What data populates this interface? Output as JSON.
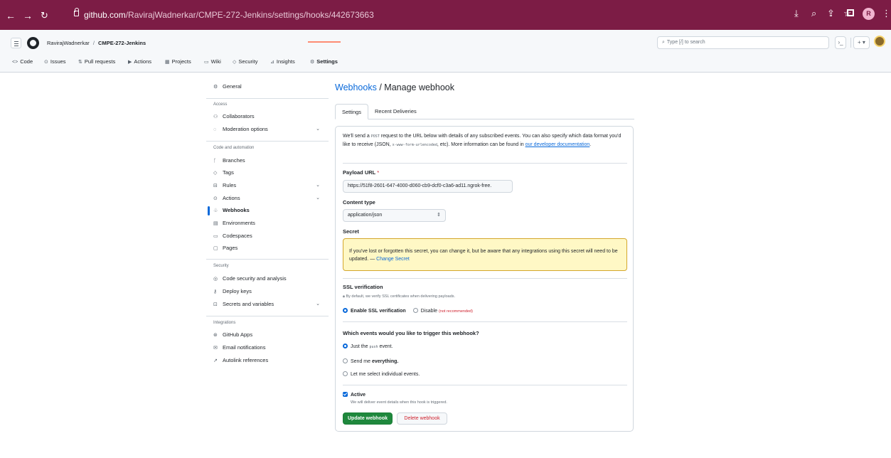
{
  "browser": {
    "url_host": "github.com",
    "url_path": "/RavirajWadnerkar/CMPE-272-Jenkins/settings/hooks/442673663",
    "profile_initial": "R"
  },
  "header": {
    "owner": "RavirajWadnerkar",
    "separator": "/",
    "repo": "CMPE-272-Jenkins",
    "search_placeholder": "Type [/] to search"
  },
  "repo_tabs": [
    {
      "icon": "code-icon",
      "glyph": "<>",
      "label": "Code"
    },
    {
      "icon": "issue-icon",
      "glyph": "⊙",
      "label": "Issues"
    },
    {
      "icon": "pull-request-icon",
      "glyph": "⇅",
      "label": "Pull requests"
    },
    {
      "icon": "actions-icon",
      "glyph": "▶",
      "label": "Actions"
    },
    {
      "icon": "projects-icon",
      "glyph": "▦",
      "label": "Projects"
    },
    {
      "icon": "wiki-icon",
      "glyph": "▭",
      "label": "Wiki"
    },
    {
      "icon": "security-icon",
      "glyph": "◇",
      "label": "Security"
    },
    {
      "icon": "insights-icon",
      "glyph": "⊿",
      "label": "Insights"
    },
    {
      "icon": "settings-icon",
      "glyph": "⚙",
      "label": "Settings"
    }
  ],
  "sidebar": {
    "general": "General",
    "access_heading": "Access",
    "collaborators": "Collaborators",
    "moderation": "Moderation options",
    "code_heading": "Code and automation",
    "branches": "Branches",
    "tags": "Tags",
    "rules": "Rules",
    "actions": "Actions",
    "webhooks": "Webhooks",
    "environments": "Environments",
    "codespaces": "Codespaces",
    "pages": "Pages",
    "security_heading": "Security",
    "code_security": "Code security and analysis",
    "deploy_keys": "Deploy keys",
    "secrets": "Secrets and variables",
    "integrations_heading": "Integrations",
    "github_apps": "GitHub Apps",
    "email_notifications": "Email notifications",
    "autolink": "Autolink references"
  },
  "main": {
    "title_link": "Webhooks",
    "title_sep": "/",
    "title_rest": "Manage webhook",
    "tab_settings": "Settings",
    "tab_deliveries": "Recent Deliveries",
    "intro_1": "We'll send a",
    "intro_post": "POST",
    "intro_2": "request to the URL below with details of any subscribed events. You can also specify which data format you'd like to receive (JSON,",
    "intro_form": "x-www-form-urlencoded",
    "intro_3": ", etc). More information can be found in",
    "intro_link": "our developer documentation",
    "intro_end": ".",
    "payload_label": "Payload URL",
    "payload_required": "*",
    "payload_value": "https://51f8-2601-647-4000-d060-cb9-dcf0-c3a6-ad11.ngrok-free.",
    "content_type_label": "Content type",
    "content_type_value": "application/json",
    "secret_label": "Secret",
    "secret_notice": "If you've lost or forgotten this secret, you can change it, but be aware that any integrations using this secret will need to be updated. —",
    "change_secret": "Change Secret",
    "ssl_label": "SSL verification",
    "ssl_note": "By default, we verify SSL certificates when delivering payloads.",
    "ssl_enable": "Enable SSL verification",
    "ssl_disable": "Disable",
    "ssl_not_recommended": "(not recommended)",
    "events_label": "Which events would you like to trigger this webhook?",
    "events_just_1": "Just the",
    "events_push": "push",
    "events_just_2": "event.",
    "events_everything_1": "Send me",
    "events_everything_2": "everything.",
    "events_individual": "Let me select individual events.",
    "active_label": "Active",
    "active_note": "We will deliver event details when this hook is triggered.",
    "update_button": "Update webhook",
    "delete_button": "Delete webhook"
  }
}
